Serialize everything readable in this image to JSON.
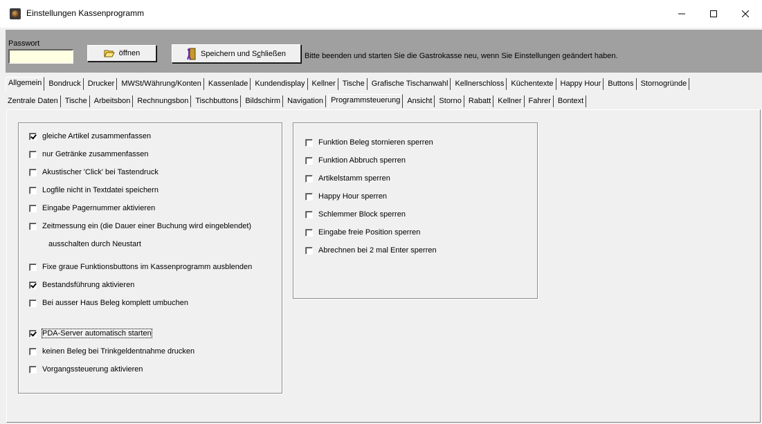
{
  "window": {
    "title": "Einstellungen Kassenprogramm"
  },
  "toolbar": {
    "password_label": "Passwort",
    "password_value": "",
    "open_label": "öffnen",
    "save_label_pre": "Speichern und S",
    "save_label_u": "c",
    "save_label_post": "hließen",
    "hint": "Bitte beenden und starten Sie die Gastrokasse neu, wenn Sie Einstellungen geändert haben."
  },
  "tabs_main": [
    "Allgemein",
    "Bondruck",
    "Drucker",
    "MWSt/Währung/Konten",
    "Kassenlade",
    "Kundendisplay",
    "Kellner",
    "Tische",
    "Grafische Tischanwahl",
    "Kellnerschloss",
    "Küchentexte",
    "Happy Hour",
    "Buttons",
    "Stornogründe"
  ],
  "tabs_sub": [
    "Zentrale Daten",
    "Tische",
    "Arbeitsbon",
    "Rechnungsbon",
    "Tischbuttons",
    "Bildschirm",
    "Navigation",
    "Programmsteuerung",
    "Ansicht",
    "Storno",
    "Rabatt",
    "Kellner",
    "Fahrer",
    "Bontext"
  ],
  "tabs_main_active": 0,
  "tabs_sub_active": 7,
  "left_options": [
    {
      "label": "gleiche Artikel zusammenfassen",
      "checked": true
    },
    {
      "label": "nur Getränke zusammenfassen",
      "checked": false
    },
    {
      "label": "Akustischer 'Click' bei Tastendruck",
      "checked": false
    },
    {
      "label": "Logfile nicht in Textdatei speichern",
      "checked": false
    },
    {
      "label": "Eingabe Pagernummer aktivieren",
      "checked": false
    },
    {
      "label": "Zeitmessung ein (die Dauer einer Buchung wird eingeblendet)",
      "checked": false
    },
    {
      "label": "Fixe graue Funktionsbuttons im Kassenprogramm ausblenden",
      "checked": false
    },
    {
      "label": "Bestandsführung aktivieren",
      "checked": true
    },
    {
      "label": "Bei ausser Haus Beleg komplett umbuchen",
      "checked": false
    },
    {
      "label": "PDA-Server automatisch starten",
      "checked": true,
      "focused": true
    },
    {
      "label": "keinen Beleg bei Trinkgeldentnahme drucken",
      "checked": false
    },
    {
      "label": "Vorgangssteuerung aktivieren",
      "checked": false
    }
  ],
  "left_note": "ausschalten durch Neustart",
  "right_options": [
    {
      "label": "Funktion Beleg stornieren sperren",
      "checked": false
    },
    {
      "label": "Funktion Abbruch sperren",
      "checked": false
    },
    {
      "label": "Artikelstamm sperren",
      "checked": false
    },
    {
      "label": "Happy Hour sperren",
      "checked": false
    },
    {
      "label": "Schlemmer Block sperren",
      "checked": false
    },
    {
      "label": "Eingabe freie Position sperren",
      "checked": false
    },
    {
      "label": "Abrechnen bei 2 mal Enter sperren",
      "checked": false
    }
  ]
}
